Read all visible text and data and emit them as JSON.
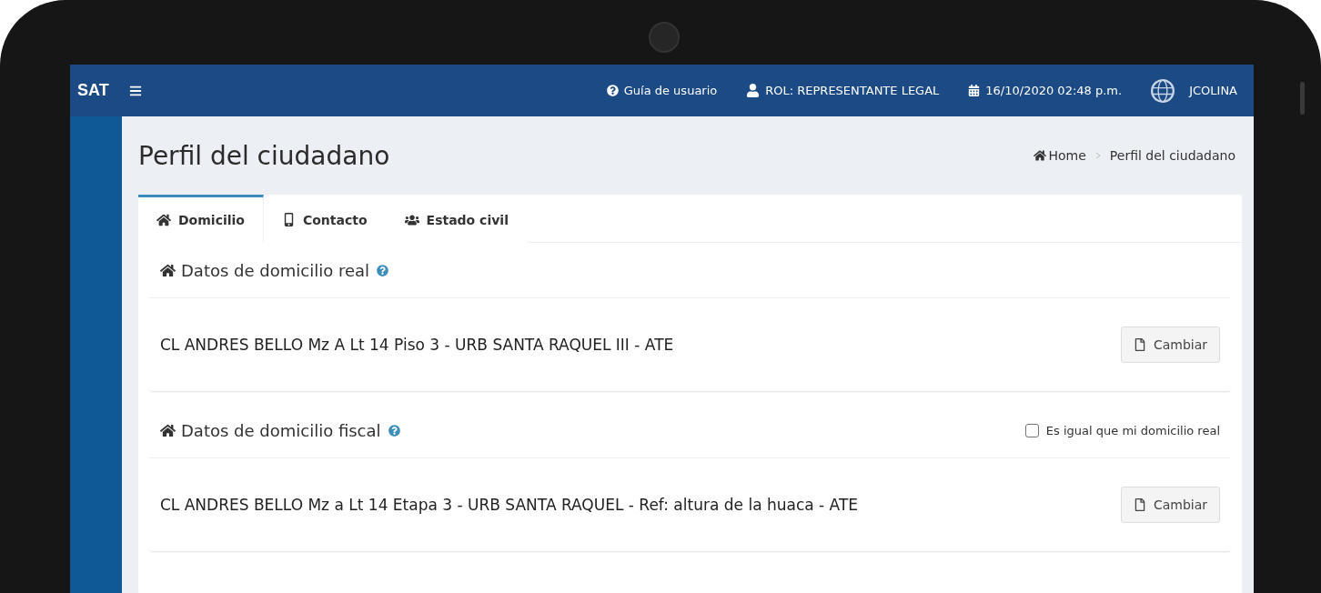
{
  "brand": "SAT",
  "topbar": {
    "guide": "Guía de usuario",
    "role": "ROL: REPRESENTANTE LEGAL",
    "datetime": "16/10/2020 02:48 p.m.",
    "user": "JCOLINA"
  },
  "page_title": "Perfil del ciudadano",
  "breadcrumb": [
    {
      "label": "Home",
      "kind": "home"
    },
    {
      "label": "Perfil del ciudadano",
      "kind": "current"
    }
  ],
  "tabs": [
    {
      "label": "Domicilio",
      "kind": "home",
      "selected": true
    },
    {
      "label": "Contacto",
      "kind": "phone",
      "selected": false
    },
    {
      "label": "Estado civil",
      "kind": "people",
      "selected": false
    }
  ],
  "sections": [
    {
      "title": "Datos de domicilio real",
      "address": "CL ANDRES BELLO Mz A Lt 14 Piso 3 - URB SANTA RAQUEL III - ATE",
      "button": "Cambiar"
    },
    {
      "title": "Datos de domicilio fiscal",
      "same_as_real": {
        "label": "Es igual que mi domicilio real",
        "checked": false
      },
      "address": "CL ANDRES BELLO Mz a Lt 14 Etapa 3 - URB SANTA RAQUEL - Ref: altura de la huaca - ATE",
      "button": "Cambiar"
    }
  ]
}
